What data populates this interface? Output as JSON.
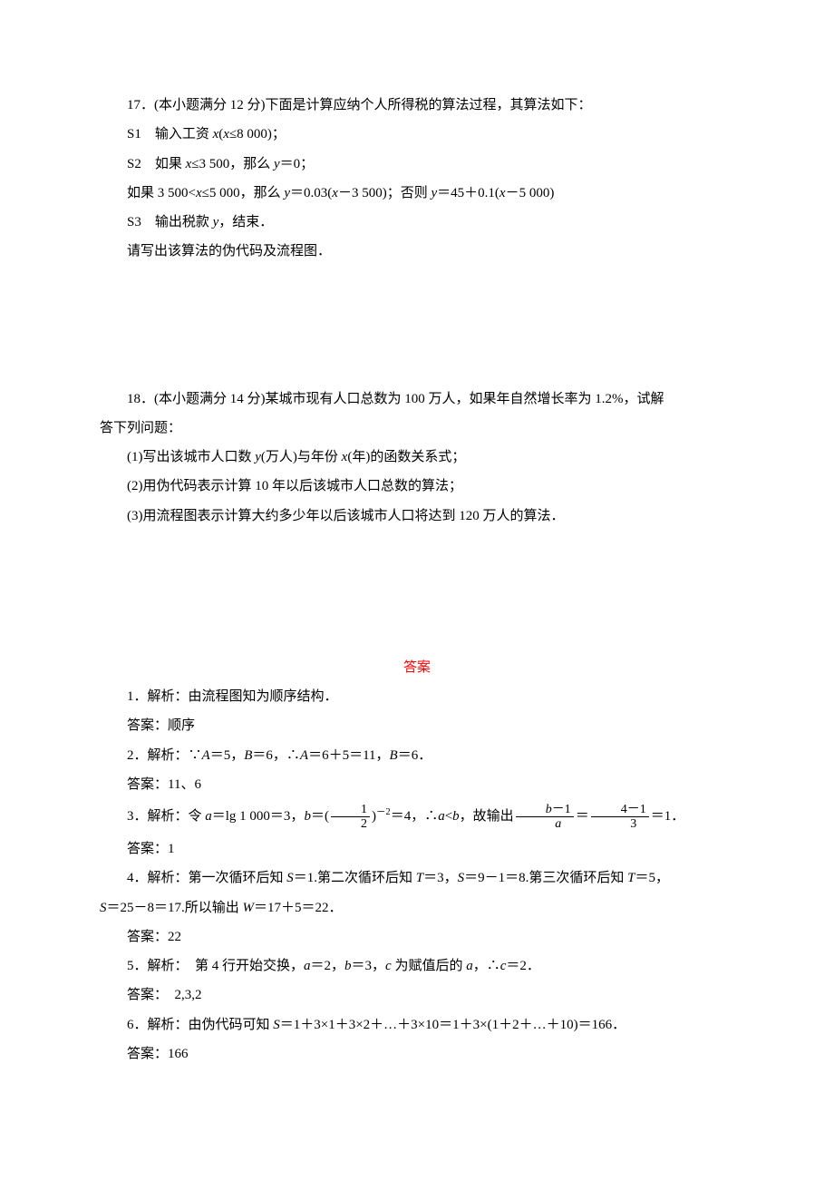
{
  "q17": {
    "title": "17．(本小题满分 12 分)下面是计算应纳个人所得税的算法过程，其算法如下：",
    "s1_a": "S1　输入工资 ",
    "s1_b": "x",
    "s1_c": "(",
    "s1_d": "x",
    "s1_e": "≤8 000)；",
    "s2_a": "S2　如果 ",
    "s2_b": "x",
    "s2_c": "≤3 500，那么 ",
    "s2_d": "y",
    "s2_e": "＝0；",
    "s2f_a": "如果 3 500<",
    "s2f_b": "x",
    "s2f_c": "≤5 000，那么 ",
    "s2f_d": "y",
    "s2f_e": "＝0.03(",
    "s2f_f": "x",
    "s2f_g": "－3 500)；否则 ",
    "s2f_h": "y",
    "s2f_i": "＝45＋0.1(",
    "s2f_j": "x",
    "s2f_k": "－5 000)",
    "s3_a": "S3　输出税款 ",
    "s3_b": "y",
    "s3_c": "，结束．",
    "ask": "请写出该算法的伪代码及流程图．"
  },
  "q18": {
    "title_a": "18．(本小题满分 14 分)某城市现有人口总数为 100 万人，如果年自然增长率为 1.2%，试解",
    "title_b": "答下列问题：",
    "p1_a": "(1)写出该城市人口数 ",
    "p1_b": "y",
    "p1_c": "(万人)与年份 ",
    "p1_d": "x",
    "p1_e": "(年)的函数关系式；",
    "p2": "(2)用伪代码表示计算 10 年以后该城市人口总数的算法；",
    "p3": "(3)用流程图表示计算大约多少年以后该城市人口将达到 120 万人的算法．"
  },
  "answer_heading": "答案",
  "a1": {
    "exp": "1．解析：由流程图知为顺序结构．",
    "ans": "答案：顺序"
  },
  "a2": {
    "exp_a": "2．解析：∵",
    "exp_b": "A",
    "exp_c": "＝5，",
    "exp_d": "B",
    "exp_e": "＝6，∴",
    "exp_f": "A",
    "exp_g": "＝6＋5＝11，",
    "exp_h": "B",
    "exp_i": "＝6．",
    "ans": "答案：11、6"
  },
  "a3": {
    "exp_a": "3．解析：令 ",
    "exp_b": "a",
    "exp_c": "＝lg 1 000＝3，",
    "exp_d": "b",
    "exp_e": "＝(",
    "frac1_num": "1",
    "frac1_den": "2",
    "exp_f": ")",
    "sup": "－2",
    "exp_g": "＝4，∴",
    "exp_h": "a",
    "exp_i": "<",
    "exp_j": "b",
    "exp_k": "，故输出",
    "frac2_num_a": "b",
    "frac2_num_b": "－1",
    "frac2_den": "a",
    "exp_l": "＝",
    "frac3_num": "4－1",
    "frac3_den": "3",
    "exp_m": "＝1．",
    "ans": "答案：1"
  },
  "a4": {
    "exp_a": "4．解析：第一次循环后知 ",
    "exp_b": "S",
    "exp_c": "＝1.第二次循环后知 ",
    "exp_d": "T",
    "exp_e": "＝3，",
    "exp_f": "S",
    "exp_g": "＝9－1＝8.第三次循环后知 ",
    "exp_h": "T",
    "exp_i": "＝5，",
    "exp2_a": "S",
    "exp2_b": "＝25－8＝17.所以输出 ",
    "exp2_c": "W",
    "exp2_d": "＝17＋5＝22．",
    "ans": "答案：22"
  },
  "a5": {
    "exp_a": "5．解析：　第 4 行开始交换，",
    "exp_b": "a",
    "exp_c": "＝2，",
    "exp_d": "b",
    "exp_e": "＝3，",
    "exp_f": "c",
    "exp_g": " 为赋值后的 ",
    "exp_h": "a",
    "exp_i": "，∴",
    "exp_j": "c",
    "exp_k": "＝2．",
    "ans": "答案：　2,3,2"
  },
  "a6": {
    "exp_a": "6．解析：由伪代码可知 ",
    "exp_b": "S",
    "exp_c": "＝1＋3×1＋3×2＋…＋3×10＝1＋3×(1＋2＋…＋10)＝166．",
    "ans": "答案：166"
  }
}
